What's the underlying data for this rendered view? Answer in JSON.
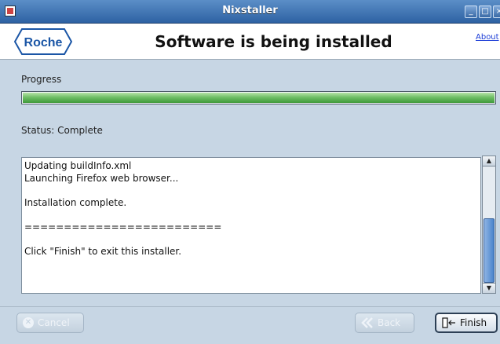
{
  "window": {
    "title": "Nixstaller",
    "controls": [
      "minimize-icon",
      "maximize-icon",
      "close-icon"
    ]
  },
  "header": {
    "logo_text": "Roche",
    "title": "Software is being installed",
    "about_link": "About"
  },
  "progress": {
    "label": "Progress",
    "fraction": 1.0
  },
  "status": {
    "text": "Status: Complete"
  },
  "log": {
    "lines": [
      "Updating buildInfo.xml",
      "Launching Firefox web browser...",
      "",
      "Installation complete.",
      "",
      "=========================",
      "",
      "Click \"Finish\" to exit this installer."
    ]
  },
  "buttons": {
    "cancel": "Cancel",
    "back": "Back",
    "finish": "Finish"
  },
  "colors": {
    "titlebar": "#2e62a3",
    "progress_fill": "#6fbf66",
    "background": "#c7d6e4"
  }
}
